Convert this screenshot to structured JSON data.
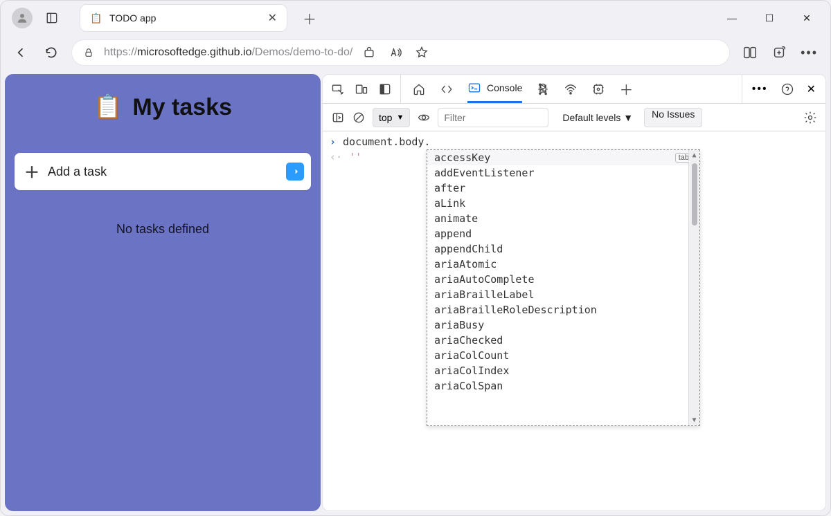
{
  "browser": {
    "tab_title": "TODO app",
    "url_prefix": "https://",
    "url_host": "microsoftedge.github.io",
    "url_path": "/Demos/demo-to-do/"
  },
  "page": {
    "title": "My tasks",
    "add_placeholder": "Add a task",
    "empty_message": "No tasks defined"
  },
  "devtools": {
    "active_tab": "Console",
    "context": "top",
    "filter_placeholder": "Filter",
    "levels": "Default levels",
    "issues": "No Issues",
    "prompt": "document.body.",
    "output": "''",
    "autocomplete_hint": "tab",
    "autocomplete": [
      "accessKey",
      "addEventListener",
      "after",
      "aLink",
      "animate",
      "append",
      "appendChild",
      "ariaAtomic",
      "ariaAutoComplete",
      "ariaBrailleLabel",
      "ariaBrailleRoleDescription",
      "ariaBusy",
      "ariaChecked",
      "ariaColCount",
      "ariaColIndex",
      "ariaColSpan"
    ]
  }
}
